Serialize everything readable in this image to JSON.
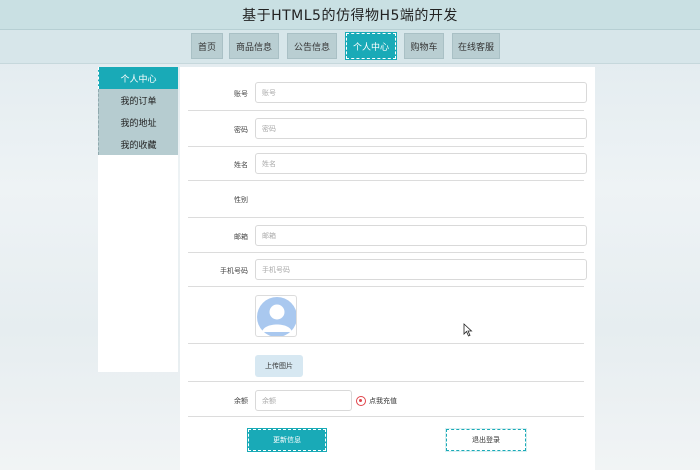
{
  "header": {
    "title": "基于HTML5的仿得物H5端的开发"
  },
  "nav": {
    "tabs": [
      {
        "label": "首页",
        "active": false
      },
      {
        "label": "商品信息",
        "active": false
      },
      {
        "label": "公告信息",
        "active": false
      },
      {
        "label": "个人中心",
        "active": true
      },
      {
        "label": "购物车",
        "active": false
      },
      {
        "label": "在线客服",
        "active": false
      }
    ]
  },
  "sidebar": {
    "items": [
      {
        "label": "个人中心",
        "active": true
      },
      {
        "label": "我的订单",
        "active": false
      },
      {
        "label": "我的地址",
        "active": false
      },
      {
        "label": "我的收藏",
        "active": false
      }
    ]
  },
  "form": {
    "account": {
      "label": "账号",
      "placeholder": "账号"
    },
    "password": {
      "label": "密码",
      "placeholder": "密码"
    },
    "name": {
      "label": "姓名",
      "placeholder": "姓名"
    },
    "gender": {
      "label": "性别"
    },
    "email": {
      "label": "邮箱",
      "placeholder": "邮箱"
    },
    "phone": {
      "label": "手机号码",
      "placeholder": "手机号码"
    },
    "avatar": {
      "icon": "user-avatar-icon"
    },
    "upload_label": "上传图片",
    "balance": {
      "label": "余额",
      "placeholder": "余额"
    },
    "recharge_label": "点我充值",
    "update_label": "更新信息",
    "logout_label": "退出登录"
  },
  "colors": {
    "accent": "#19aab7",
    "tab_bg": "#b9ced2",
    "recharge": "#e0454b"
  }
}
